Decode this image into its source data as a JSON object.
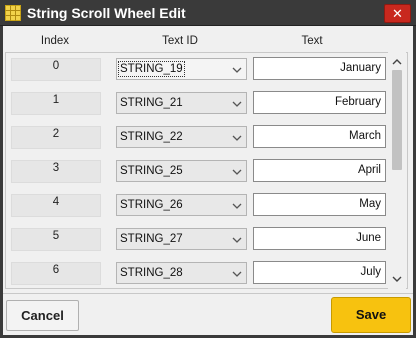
{
  "window": {
    "title": "String Scroll Wheel Edit",
    "close_label": "✕",
    "app_icon": "grid-icon",
    "title_bar_color": "#3a3a3a",
    "close_color": "#c8281e"
  },
  "headers": {
    "index": "Index",
    "text_id": "Text ID",
    "text": "Text"
  },
  "rows": [
    {
      "index": "0",
      "text_id": "STRING_19",
      "text": "January"
    },
    {
      "index": "1",
      "text_id": "STRING_21",
      "text": "February"
    },
    {
      "index": "2",
      "text_id": "STRING_22",
      "text": "March"
    },
    {
      "index": "3",
      "text_id": "STRING_25",
      "text": "April"
    },
    {
      "index": "4",
      "text_id": "STRING_26",
      "text": "May"
    },
    {
      "index": "5",
      "text_id": "STRING_27",
      "text": "June"
    },
    {
      "index": "6",
      "text_id": "STRING_28",
      "text": "July"
    }
  ],
  "footer": {
    "cancel_label": "Cancel",
    "save_label": "Save",
    "save_color": "#f7c20f"
  }
}
